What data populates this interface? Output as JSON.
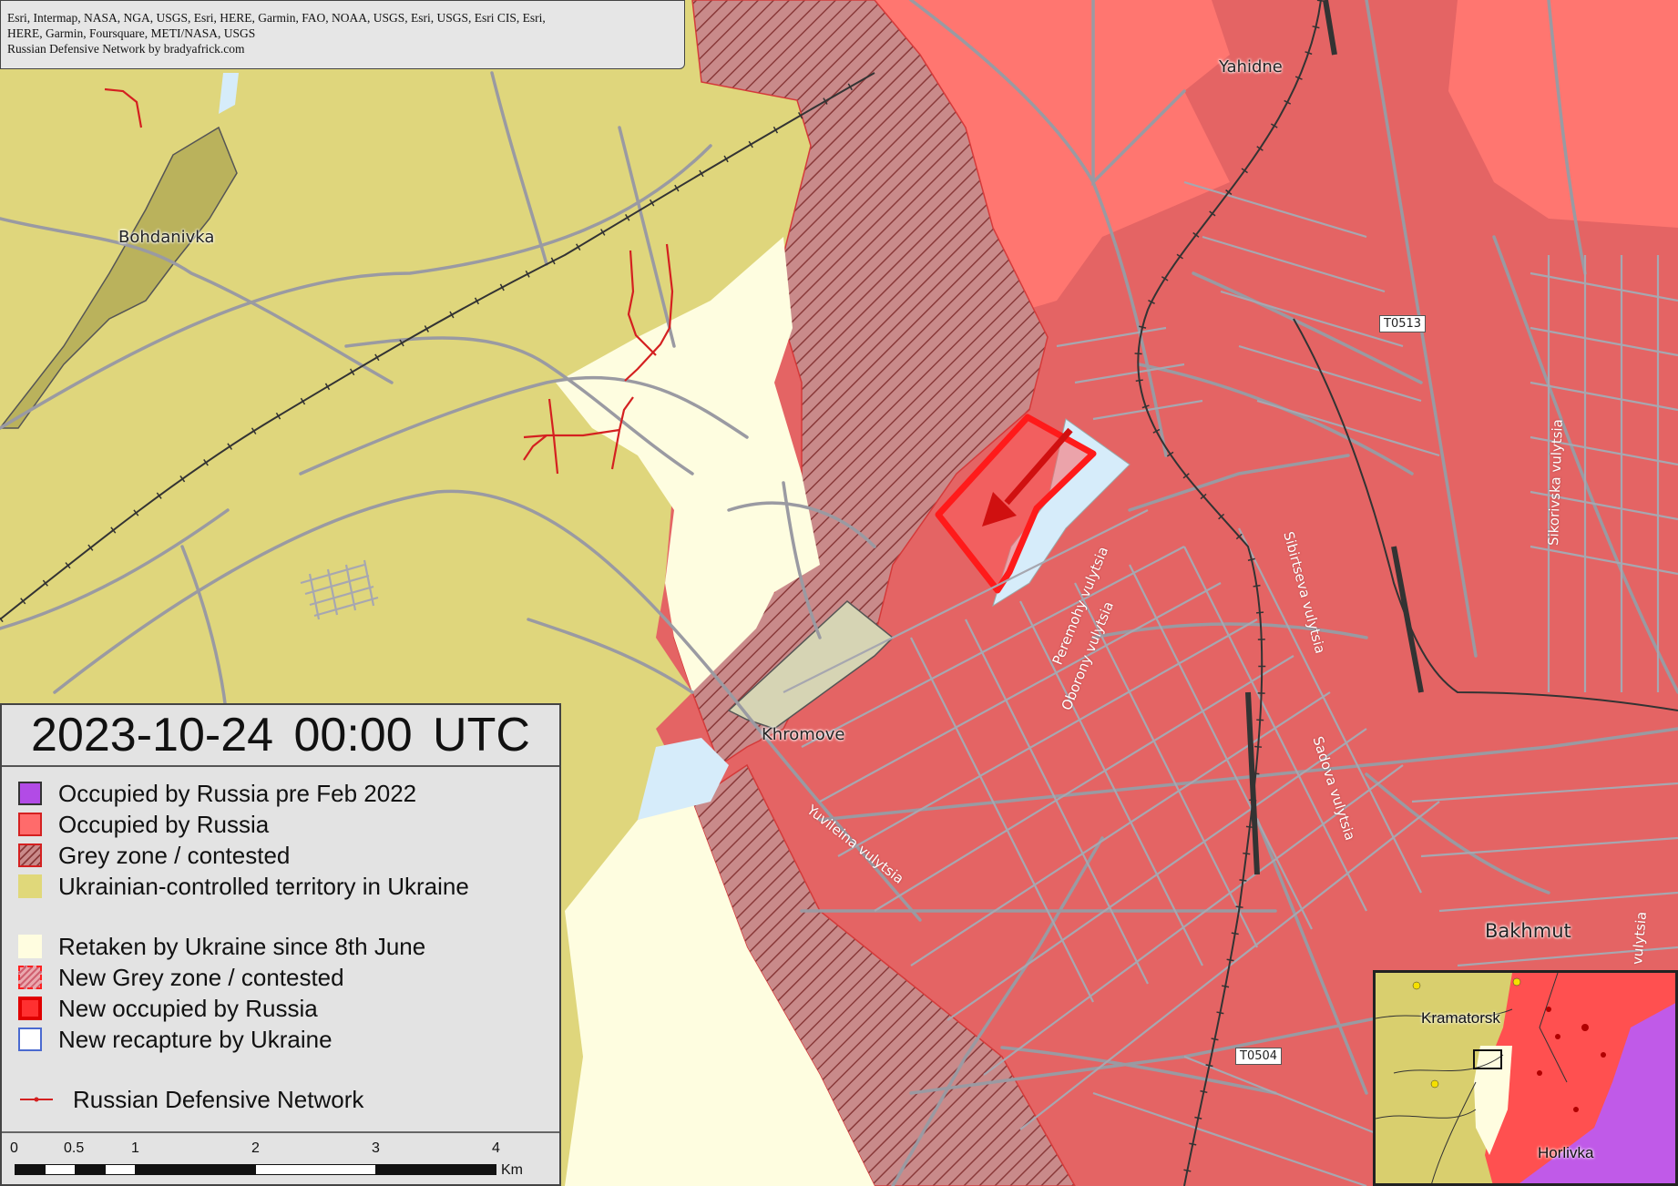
{
  "attribution": {
    "line1": "Esri, Intermap, NASA, NGA, USGS, Esri, HERE, Garmin, FAO, NOAA, USGS, Esri, USGS, Esri CIS, Esri,",
    "line2": "HERE, Garmin, Foursquare, METI/NASA, USGS",
    "line3": "Russian Defensive Network by bradyafrick.com"
  },
  "places": {
    "bohdanivka": "Bohdanivka",
    "yahidne": "Yahidne",
    "khromove": "Khromove",
    "bakhmut": "Bakhmut"
  },
  "streets": {
    "peremohy": "Peremohy vulytsia",
    "oborony": "Oborony vulytsia",
    "sibirtseva": "Sibirtseva vulytsia",
    "sadova": "Sadova vulytsia",
    "yuvileina": "Yuvileina vulytsia",
    "sikorivska": "Sikorivska vulytsia",
    "edge": "vulytsia"
  },
  "road_shields": {
    "t0513": "T0513",
    "t0504": "T0504"
  },
  "timestamp": "2023-10-24  00:00 UTC",
  "legend": {
    "items": [
      {
        "label": "Occupied by Russia pre Feb 2022",
        "color": "#b24be6"
      },
      {
        "label": "Occupied by Russia",
        "color": "#ff6b6b"
      },
      {
        "label": "Grey zone / contested",
        "color": "#c98a8a"
      },
      {
        "label": "Ukrainian-controlled territory in Ukraine",
        "color": "#e0d87a"
      },
      {
        "label": "Retaken by Ukraine since 8th June",
        "color": "#fffde0"
      },
      {
        "label": "New Grey zone / contested",
        "color": "#e8a0a8"
      },
      {
        "label": "New occupied by Russia",
        "color": "#ff3030"
      },
      {
        "label": "New recapture by Ukraine",
        "color": "#ffffff"
      },
      {
        "label": "Russian Defensive Network",
        "color": "#d42020"
      }
    ]
  },
  "scale": {
    "ticks": [
      "0",
      "0.5",
      "1",
      "2",
      "3",
      "4"
    ],
    "unit": "Km"
  },
  "inset": {
    "kramatorsk": "Kramatorsk",
    "horlivka": "Horlivka"
  },
  "colors": {
    "occupied": "#e46464",
    "ukraine": "#dfd67c",
    "retaken": "#fefde0",
    "water": "#d6ecfa",
    "road": "#9a9aa2"
  }
}
